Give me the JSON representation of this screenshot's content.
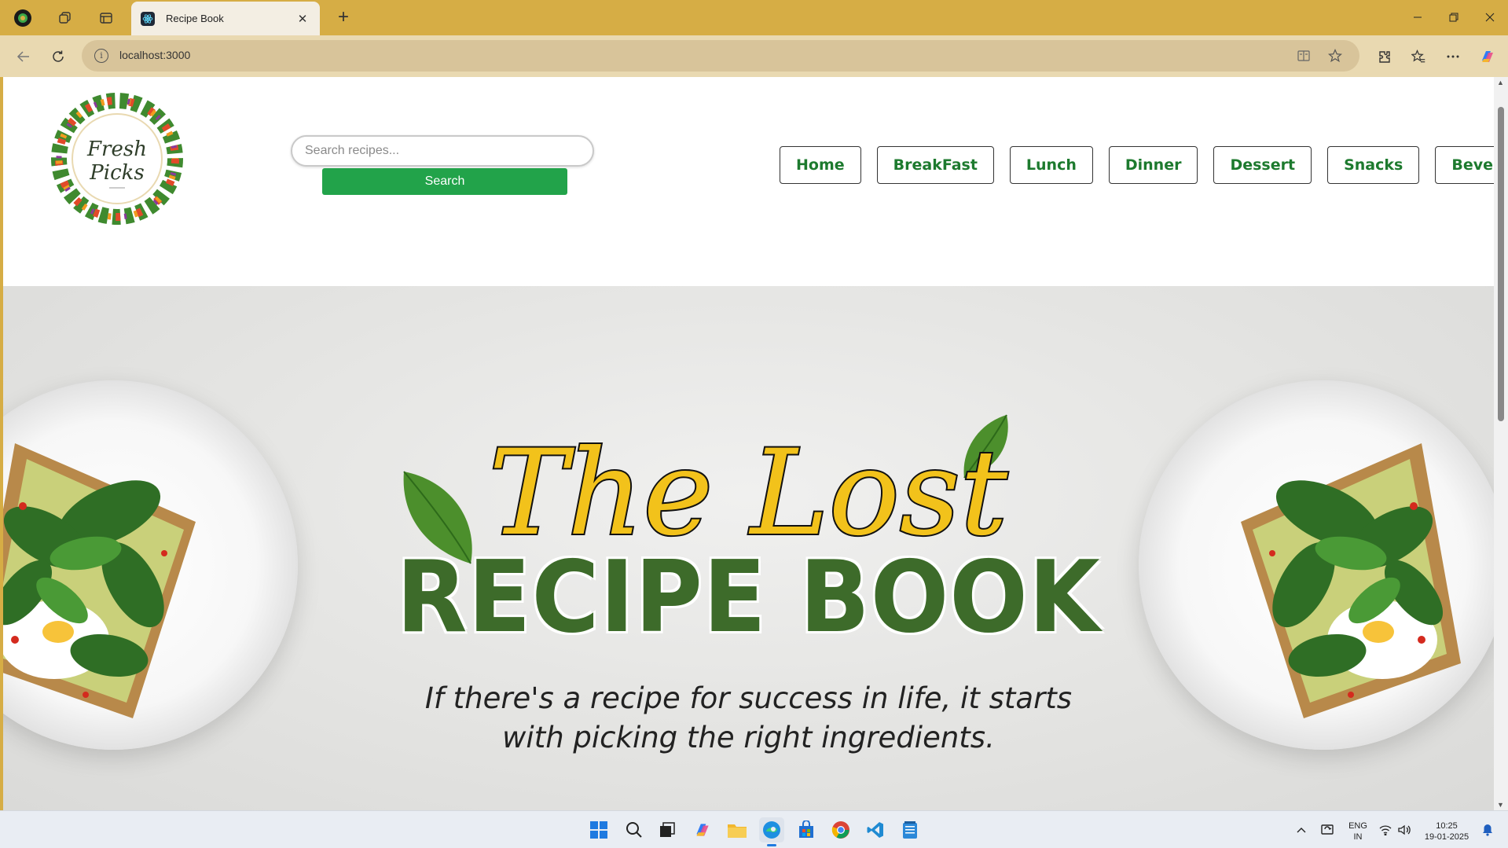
{
  "browser": {
    "tab_title": "Recipe Book",
    "url": "localhost:3000",
    "new_tab_symbol": "+",
    "tab_close_symbol": "✕"
  },
  "site": {
    "logo": {
      "line1": "Fresh",
      "line2": "Picks"
    },
    "search": {
      "placeholder": "Search recipes...",
      "button_label": "Search"
    },
    "nav": [
      {
        "label": "Home"
      },
      {
        "label": "BreakFast"
      },
      {
        "label": "Lunch"
      },
      {
        "label": "Dinner"
      },
      {
        "label": "Dessert"
      },
      {
        "label": "Snacks"
      },
      {
        "label": "Beverages"
      }
    ],
    "hero": {
      "script_title": "The Lost",
      "main_title": "RECIPE BOOK",
      "tagline_line1": "If there's a recipe for success in life, it starts",
      "tagline_line2": "with picking the right ingredients."
    }
  },
  "taskbar": {
    "apps": [
      {
        "name": "start-icon"
      },
      {
        "name": "search-icon"
      },
      {
        "name": "task-view-icon"
      },
      {
        "name": "copilot-icon"
      },
      {
        "name": "file-explorer-icon"
      },
      {
        "name": "edge-icon"
      },
      {
        "name": "store-icon"
      },
      {
        "name": "chrome-icon"
      },
      {
        "name": "vscode-icon"
      },
      {
        "name": "notepad-icon"
      }
    ],
    "tray": {
      "lang_line1": "ENG",
      "lang_line2": "IN",
      "time": "10:25",
      "date": "19-01-2025"
    }
  },
  "colors": {
    "chrome_accent": "#d6ad45",
    "nav_text": "#1d7a2e",
    "search_button": "#22a34a",
    "hero_title": "#3d6b2a",
    "script_title_fill": "#f2c21b"
  }
}
